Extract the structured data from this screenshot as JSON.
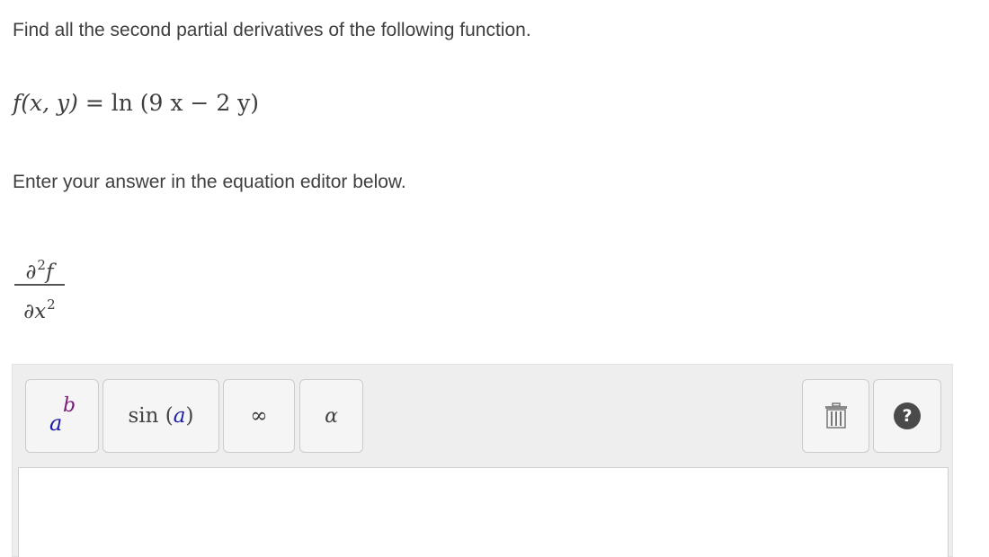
{
  "question": {
    "prompt": "Find all the second partial derivatives of the following function.",
    "function_lhs": "f(x, y)",
    "function_eq": " = ",
    "function_rhs": "ln (9 x − 2 y)",
    "instruction": "Enter your answer in the equation editor below."
  },
  "answer_label": {
    "numerator_d": "∂",
    "numerator_exp": "2",
    "numerator_f": "f",
    "denominator_d": "∂",
    "denominator_x": "x",
    "denominator_exp": "2"
  },
  "toolbar": {
    "power": {
      "base": "a",
      "exponent": "b",
      "icon": "power-icon"
    },
    "sin": {
      "func": "sin",
      "open": " (",
      "arg": "a",
      "close": ")"
    },
    "infinity": {
      "symbol": "∞"
    },
    "alpha": {
      "symbol": "α"
    },
    "trash": {
      "icon": "trash-icon"
    },
    "help": {
      "symbol": "?",
      "icon": "help-icon"
    }
  },
  "editor": {
    "value": ""
  }
}
